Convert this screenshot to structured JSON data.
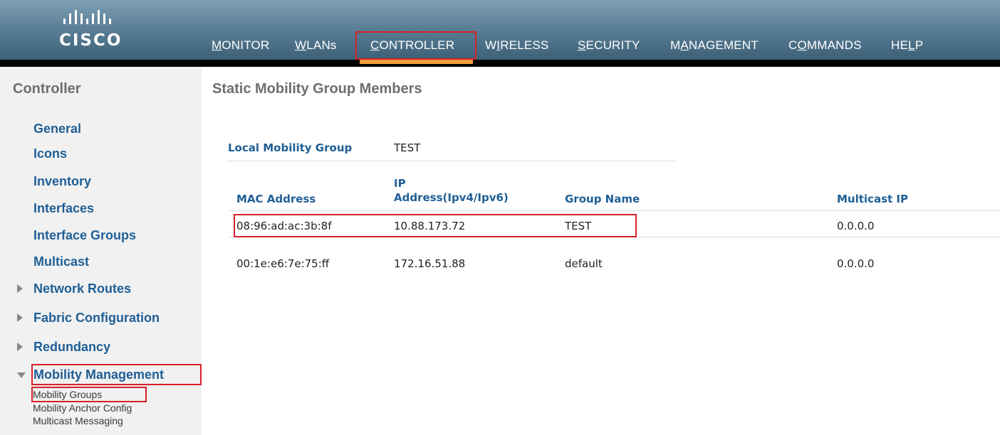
{
  "brand": {
    "logo_text": "CISCO"
  },
  "nav": [
    {
      "id": "monitor",
      "prefix": "",
      "underline": "M",
      "suffix": "ONITOR"
    },
    {
      "id": "wlans",
      "prefix": "",
      "underline": "W",
      "suffix": "LANs"
    },
    {
      "id": "controller",
      "prefix": "",
      "underline": "C",
      "suffix": "ONTROLLER"
    },
    {
      "id": "wireless",
      "prefix": "W",
      "underline": "I",
      "suffix": "RELESS"
    },
    {
      "id": "security",
      "prefix": "",
      "underline": "S",
      "suffix": "ECURITY"
    },
    {
      "id": "management",
      "prefix": "M",
      "underline": "A",
      "suffix": "NAGEMENT"
    },
    {
      "id": "commands",
      "prefix": "C",
      "underline": "O",
      "suffix": "MMANDS"
    },
    {
      "id": "help",
      "prefix": "HE",
      "underline": "L",
      "suffix": "P"
    }
  ],
  "nav_active": "CONTROLLER",
  "sidebar": {
    "title": "Controller",
    "items": [
      {
        "label": "General"
      },
      {
        "label": "Icons"
      },
      {
        "label": "Inventory"
      },
      {
        "label": "Interfaces"
      },
      {
        "label": "Interface Groups"
      },
      {
        "label": "Multicast"
      },
      {
        "label": "Network Routes"
      },
      {
        "label": "Fabric Configuration"
      },
      {
        "label": "Redundancy"
      },
      {
        "label": "Mobility Management"
      }
    ],
    "sub_items": [
      {
        "label": "Mobility Groups"
      },
      {
        "label": "Mobility Anchor Config"
      },
      {
        "label": "Multicast Messaging"
      }
    ]
  },
  "main": {
    "title": "Static Mobility Group Members",
    "local_group": {
      "label": "Local Mobility Group",
      "value": "TEST"
    },
    "table": {
      "headers": {
        "mac": "MAC Address",
        "ip_line1": "IP",
        "ip_line2": "Address(Ipv4/Ipv6)",
        "group": "Group Name",
        "multicast": "Multicast IP"
      },
      "rows": [
        {
          "mac": "08:96:ad:ac:3b:8f",
          "ip": "10.88.173.72",
          "group": "TEST",
          "multicast": "0.0.0.0"
        },
        {
          "mac": "00:1e:e6:7e:75:ff",
          "ip": "172.16.51.88",
          "group": "default",
          "multicast": "0.0.0.0"
        }
      ]
    }
  },
  "colors": {
    "header_top": "#7e9fb4",
    "header_bottom": "#3c6177",
    "active_tab": "#f39c3a",
    "highlight": "#d8202a",
    "link": "#1f5f96",
    "sidebar_bg": "#f1f1f1"
  }
}
